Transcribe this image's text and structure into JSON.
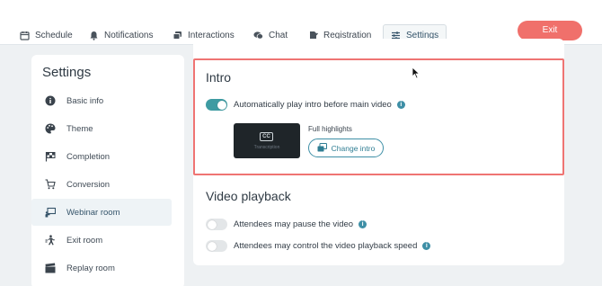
{
  "tabs": [
    {
      "label": "Schedule",
      "icon": "calendar-icon"
    },
    {
      "label": "Notifications",
      "icon": "bell-icon"
    },
    {
      "label": "Interactions",
      "icon": "interactions-icon"
    },
    {
      "label": "Chat",
      "icon": "chat-icon"
    },
    {
      "label": "Registration",
      "icon": "registration-icon"
    },
    {
      "label": "Settings",
      "icon": "sliders-icon",
      "active": true
    }
  ],
  "exit_label": "Exit",
  "sidebar": {
    "title": "Settings",
    "items": [
      {
        "label": "Basic info",
        "icon": "info-icon"
      },
      {
        "label": "Theme",
        "icon": "palette-icon"
      },
      {
        "label": "Completion",
        "icon": "checkered-flag-icon"
      },
      {
        "label": "Conversion",
        "icon": "cart-icon"
      },
      {
        "label": "Webinar room",
        "icon": "presentation-icon",
        "active": true
      },
      {
        "label": "Exit room",
        "icon": "exit-person-icon"
      },
      {
        "label": "Replay room",
        "icon": "clapperboard-icon"
      }
    ]
  },
  "intro": {
    "title": "Intro",
    "autoplay_label": "Automatically play intro before main video",
    "autoplay_on": true,
    "thumbnail_badge": "CC",
    "thumbnail_caption": "Transcription",
    "video_name": "Full highlights",
    "change_label": "Change intro"
  },
  "playback": {
    "title": "Video playback",
    "options": [
      {
        "label": "Attendees may pause the video",
        "on": false
      },
      {
        "label": "Attendees may control the video playback speed",
        "on": false
      }
    ]
  },
  "colors": {
    "accent": "#3e9ba2",
    "exit": "#f0706b",
    "highlight_border": "#ef7473"
  }
}
